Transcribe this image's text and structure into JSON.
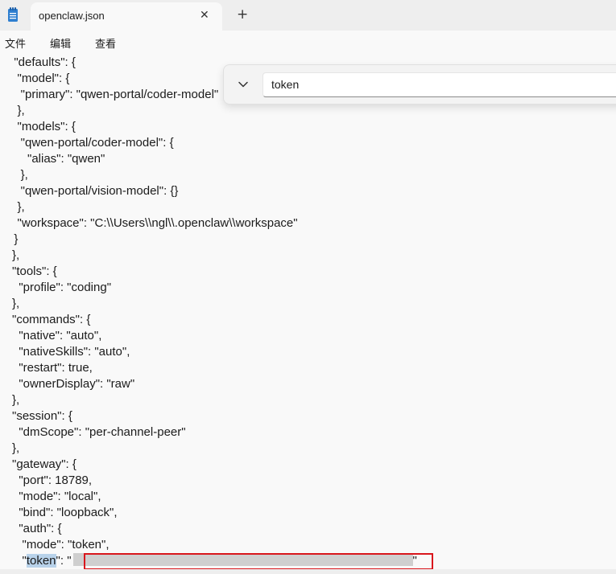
{
  "window": {
    "tab_title": "openclaw.json",
    "tab_close_glyph": "✕",
    "new_tab_glyph": "+"
  },
  "menu": {
    "file": "文件",
    "edit": "编辑",
    "view": "查看"
  },
  "find": {
    "query": "token"
  },
  "editor": {
    "lines": [
      "  \"defaults\": {",
      "   \"model\": {",
      "    \"primary\": \"qwen-portal/coder-model\"",
      "   },",
      "   \"models\": {",
      "    \"qwen-portal/coder-model\": {",
      "      \"alias\": \"qwen\"",
      "    },",
      "    \"qwen-portal/vision-model\": {}",
      "   },",
      "   \"workspace\": \"C:\\\\Users\\\\ngl\\\\.openclaw\\\\workspace\"",
      "  }",
      "},",
      "\"tools\": {",
      "  \"profile\": \"coding\"",
      "},",
      "\"commands\": {",
      "  \"native\": \"auto\",",
      "  \"nativeSkills\": \"auto\",",
      "  \"restart\": true,",
      "  \"ownerDisplay\": \"raw\"",
      "},",
      "\"session\": {",
      "  \"dmScope\": \"per-channel-peer\"",
      "},",
      "\"gateway\": {",
      "  \"port\": 18789,",
      "  \"mode\": \"local\",",
      "  \"bind\": \"loopback\",",
      "  \"auth\": {",
      "   \"mode\": \"token\","
    ],
    "token_line": {
      "prefix": "   \"",
      "match": "token",
      "middle": "\": \"",
      "suffix": "\""
    }
  }
}
